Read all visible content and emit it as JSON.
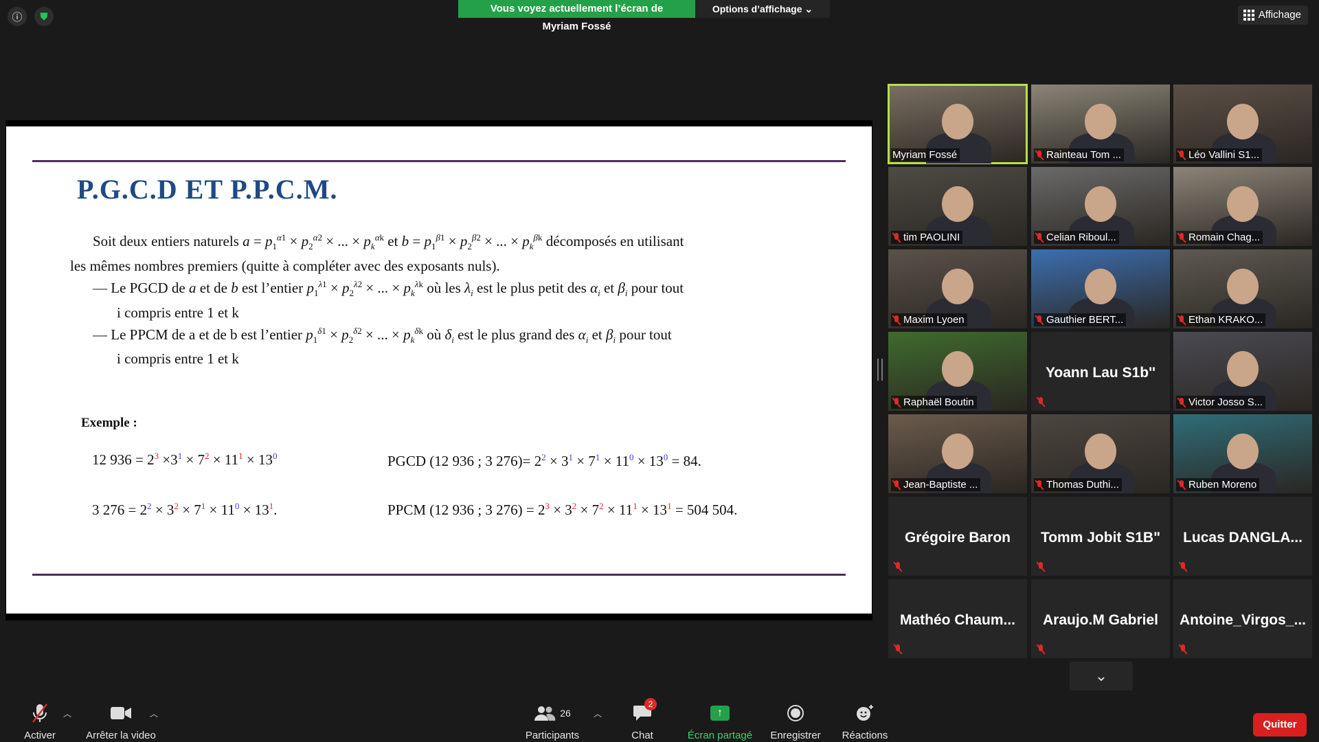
{
  "topbar": {
    "info_icon": "info-circle-icon",
    "shield_icon": "shield-check-icon",
    "banner_text": "Vous voyez actuellement l’écran de Myriam Fossé",
    "options_label": "Options d’affichage",
    "affichage_label": "Affichage"
  },
  "slide": {
    "title": "P.G.C.D ET P.P.C.M.",
    "intro_line1_a": "Soit deux entiers naturels ",
    "intro_line1_b": " décomposés en utilisant",
    "intro_line2": "les mêmes nombres premiers (quitte à compléter avec des exposants nuls).",
    "pgcd_a": "— Le PGCD de ",
    "pgcd_b": " est le plus petit des ",
    "pgcd_c": " pour tout",
    "pgcd_line2": "i compris entre 1 et k",
    "ppcm_a": "— Le PPCM de a et de b est l’entier ",
    "ppcm_b": " est le plus grand des ",
    "ppcm_c": " pour tout",
    "ppcm_line2": "i compris entre 1 et k",
    "example_label": "Exemple :",
    "ex1_left": "12 936 = ",
    "ex1_right": "PGCD (12 936 ; 3 276)= ",
    "ex1_result": " = 84.",
    "ex2_left": "3 276 = ",
    "ex2_right": "PPCM (12 936 ; 3 276) = ",
    "ex2_result": " = 504 504."
  },
  "participants": [
    {
      "name": "Myriam Fossé",
      "video": true,
      "muted": false,
      "active": true
    },
    {
      "name": "Rainteau Tom ...",
      "video": true,
      "muted": true
    },
    {
      "name": "Léo Vallini S1...",
      "video": true,
      "muted": true
    },
    {
      "name": "tim PAOLINI",
      "video": true,
      "muted": true
    },
    {
      "name": "Celian Riboul...",
      "video": true,
      "muted": true
    },
    {
      "name": "Romain Chag...",
      "video": true,
      "muted": true
    },
    {
      "name": "Maxim Lyoen",
      "video": true,
      "muted": true
    },
    {
      "name": "Gauthier BERT...",
      "video": true,
      "muted": true
    },
    {
      "name": "Ethan KRAKO...",
      "video": true,
      "muted": true
    },
    {
      "name": "Raphaël Boutin",
      "video": true,
      "muted": true
    },
    {
      "name": "Yoann Lau S1b''",
      "video": false,
      "muted": true
    },
    {
      "name": "Victor Josso S...",
      "video": true,
      "muted": true
    },
    {
      "name": "Jean-Baptiste ...",
      "video": true,
      "muted": true
    },
    {
      "name": "Thomas Duthi...",
      "video": true,
      "muted": true
    },
    {
      "name": "Ruben Moreno",
      "video": true,
      "muted": true
    },
    {
      "name": "Grégoire Baron",
      "video": false,
      "muted": true
    },
    {
      "name": "Tomm Jobit S1B\"",
      "video": false,
      "muted": true
    },
    {
      "name": "Lucas  DANGLA...",
      "video": false,
      "muted": true
    },
    {
      "name": "Mathéo  Chaum...",
      "video": false,
      "muted": true
    },
    {
      "name": "Araujo.M Gabriel",
      "video": false,
      "muted": true
    },
    {
      "name": "Antoine_Virgos_...",
      "video": false,
      "muted": true
    }
  ],
  "toolbar": {
    "activer": "Activer",
    "video": "Arrêter la video",
    "participants_count": "26",
    "participants": "Participants",
    "chat": "Chat",
    "chat_badge": "2",
    "share": "Écran partagé",
    "record": "Enregistrer",
    "reactions": "Réactions",
    "quit": "Quitter"
  }
}
